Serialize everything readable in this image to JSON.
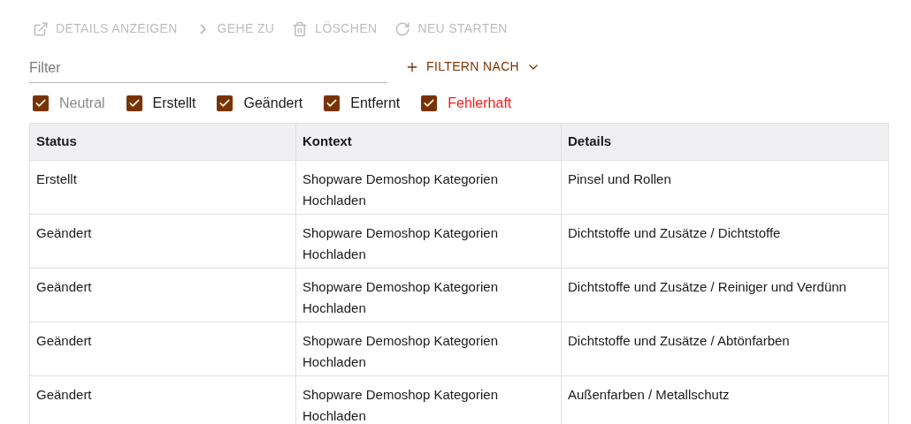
{
  "toolbar": [
    {
      "kind": "details",
      "label": "DETAILS ANZEIGEN",
      "disabled": true
    },
    {
      "kind": "goto",
      "label": "GEHE ZU",
      "disabled": true
    },
    {
      "kind": "delete",
      "label": "LÖSCHEN",
      "disabled": true
    },
    {
      "kind": "restart",
      "label": "NEU STARTEN",
      "disabled": true
    }
  ],
  "filter": {
    "placeholder": "Filter"
  },
  "filter_by_button": {
    "label": "FILTERN NACH"
  },
  "status_filters": [
    {
      "label": "Neutral",
      "checked": true,
      "color": "#8a8a8a"
    },
    {
      "label": "Erstellt",
      "checked": true,
      "color": "#1a1a1a"
    },
    {
      "label": "Geändert",
      "checked": true,
      "color": "#1a1a1a"
    },
    {
      "label": "Entfernt",
      "checked": true,
      "color": "#1a1a1a"
    },
    {
      "label": "Fehlerhaft",
      "checked": true,
      "color": "#ff1a1a"
    }
  ],
  "table": {
    "columns": [
      "Status",
      "Kontext",
      "Details"
    ],
    "rows": [
      [
        "Erstellt",
        "Shopware Demoshop Kategorien Hochladen",
        "Pinsel und Rollen"
      ],
      [
        "Geändert",
        "Shopware Demoshop Kategorien Hochladen",
        "Dichtstoffe und Zusätze / Dichtstoffe"
      ],
      [
        "Geändert",
        "Shopware Demoshop Kategorien Hochladen",
        "Dichtstoffe und Zusätze / Reiniger und Verdünn"
      ],
      [
        "Geändert",
        "Shopware Demoshop Kategorien Hochladen",
        "Dichtstoffe und Zusätze / Abtönfarben"
      ],
      [
        "Geändert",
        "Shopware Demoshop Kategorien Hochladen",
        "Außenfarben / Metallschutz"
      ]
    ]
  }
}
